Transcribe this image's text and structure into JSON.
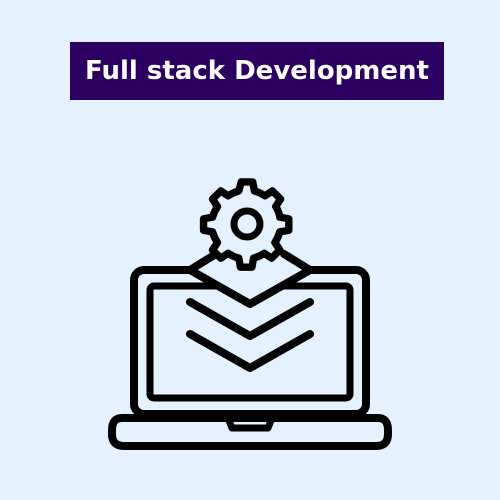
{
  "page": {
    "background_color": "#e4f1fe"
  },
  "title": {
    "text": "Full stack Development",
    "background_color": "#2b0060",
    "text_color": "#ffffff"
  },
  "illustration": {
    "icon": "laptop-with-gear-and-layers-icon",
    "stroke_color": "#000000"
  }
}
